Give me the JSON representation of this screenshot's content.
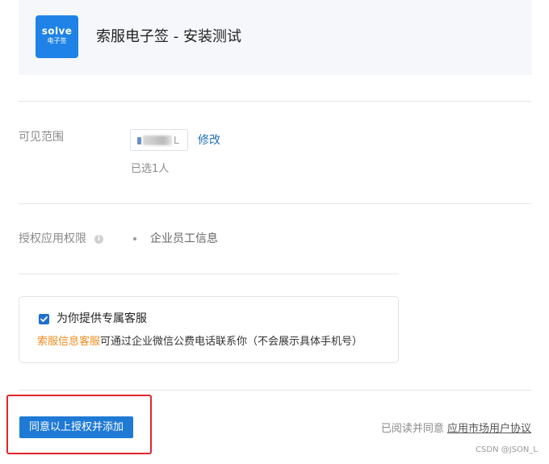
{
  "header": {
    "logo_text": "SOLVE",
    "logo_subtext": "电子签",
    "title": "索服电子签 - 安装测试",
    "logo_color": "#1f82e6"
  },
  "visibility": {
    "label": "可见范围",
    "member_chip_tail": "L",
    "modify_link": "修改",
    "selected_count": "已选1人"
  },
  "permissions": {
    "label": "授权应用权限",
    "info_icon": "info-icon",
    "items": [
      "企业员工信息"
    ]
  },
  "service": {
    "checkbox_checked": true,
    "title": "为你提供专属客服",
    "desc_highlight": "索服信息客服",
    "desc_rest": "可通过企业微信公费电话联系你（不会展示具体手机号）",
    "highlight_color": "#f08a1c"
  },
  "footer": {
    "agree_button": "同意以上授权并添加",
    "agreement_prefix": "已阅读并同意",
    "agreement_link": "应用市场用户协议"
  },
  "watermark": "CSDN @JSON_L",
  "colors": {
    "accent": "#1f7ad6",
    "link": "#1f6fb8",
    "annotation_red": "#e0262a"
  }
}
